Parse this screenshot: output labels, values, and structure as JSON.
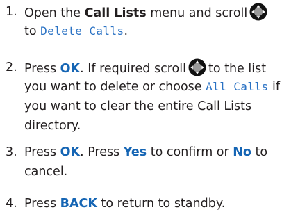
{
  "steps": [
    {
      "number": "1.",
      "l1a": "Open the ",
      "l1b": "Call Lists",
      "l1c": " menu and scroll",
      "l2a": "to ",
      "l2b": "Delete Calls",
      "l2c": "."
    },
    {
      "number": "2.",
      "l1a": "Press ",
      "l1b": "OK",
      "l1c": ". If required scroll",
      "l1d": "to the list",
      "l2a": "you want to delete or choose ",
      "l2b": "All Calls",
      "l2c": " if",
      "l3": "you want to clear the entire Call Lists",
      "l4": "directory."
    },
    {
      "number": "3.",
      "l1a": "Press ",
      "l1b": "OK",
      "l1c": ". Press ",
      "l1d": "Yes",
      "l1e": " to confirm or ",
      "l1f": "No",
      "l1g": " to",
      "l2": "cancel."
    },
    {
      "number": "4.",
      "l1a": "Press ",
      "l1b": "BACK",
      "l1c": " to return to standby."
    }
  ],
  "icons": {
    "nav": "navigation-key-icon"
  },
  "colors": {
    "text": "#231f20",
    "key": "#1565b4",
    "display": "#2a72c4"
  }
}
